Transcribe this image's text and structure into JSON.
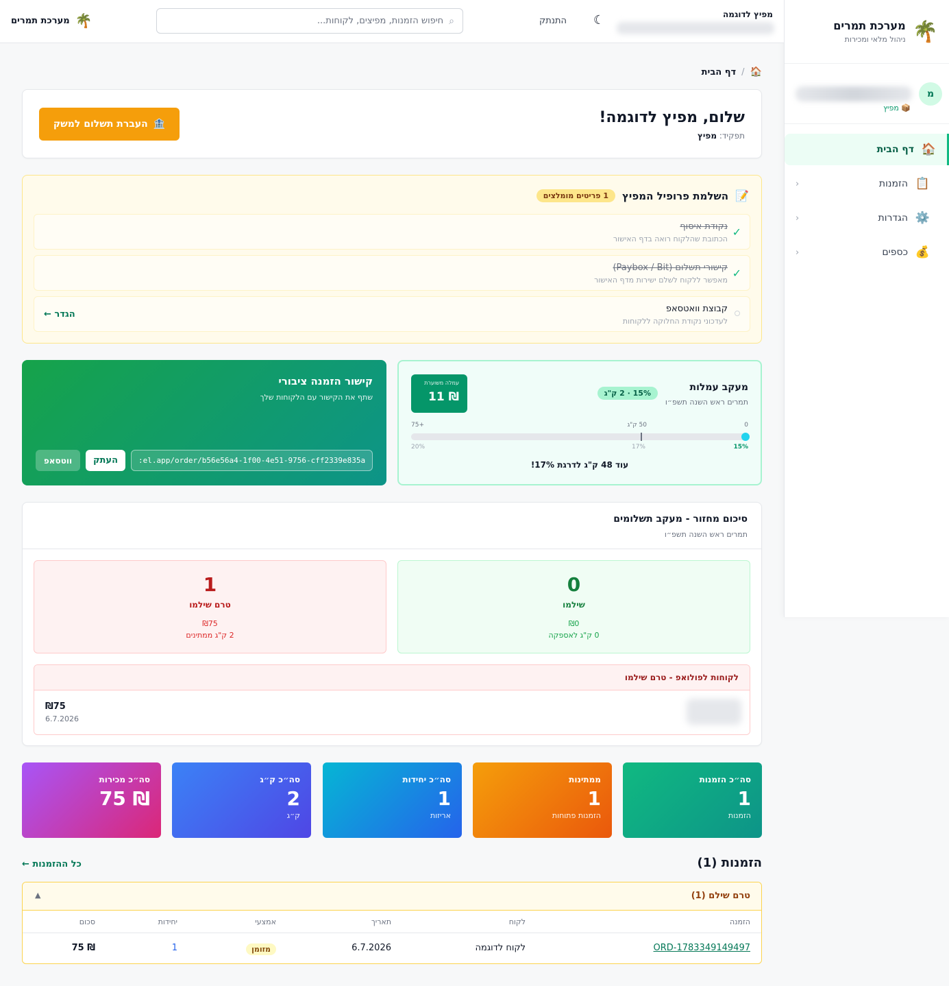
{
  "sidebar": {
    "brand_title": "מערכת תמרים",
    "brand_subtitle": "ניהול מלאי ומכירות",
    "avatar_letter": "מ",
    "role_tag": "📦 מפיץ",
    "items": [
      {
        "label": "דף הבית",
        "icon": "house-icon",
        "glyph": "🏠",
        "active": true
      },
      {
        "label": "הזמנות",
        "icon": "clipboard-icon",
        "glyph": "📋"
      },
      {
        "label": "הגדרות",
        "icon": "gear-icon",
        "glyph": "⚙️"
      },
      {
        "label": "כספים",
        "icon": "money-bag-icon",
        "glyph": "💰"
      }
    ]
  },
  "topbar": {
    "user_name": "מפיץ לדוגמה",
    "logout": "התנתק",
    "search_placeholder": "חיפוש הזמנות, מפיצים, לקוחות...",
    "brand": "מערכת תמרים"
  },
  "breadcrumb": {
    "current": "דף הבית"
  },
  "welcome": {
    "title": "שלום, מפיץ לדוגמה!",
    "role_label": "תפקיד:",
    "role_value": "מפיץ",
    "transfer_button": "העברת תשלום למשק"
  },
  "profile": {
    "title": "השלמת פרופיל המפיץ",
    "badge": "1 פריטים מומלצים",
    "items": [
      {
        "title": "נקודת איסוף",
        "subtitle": "הכתובת שהלקוח רואה בדף האישור",
        "done": true
      },
      {
        "title": "קישורי תשלום (Paybox / Bit)",
        "subtitle": "מאפשר ללקוח לשלם ישירות מדף האישור",
        "done": true
      },
      {
        "title": "קבוצת וואטסאפ",
        "subtitle": "לעדכוני נקודת החלוקה ללקוחות",
        "done": false,
        "action": "הגדר ←"
      }
    ]
  },
  "public_link": {
    "title": "קישור הזמנה ציבורי",
    "subtitle": "שתף את הקישור עם הלקוחות שלך",
    "url": ":el.app/order/b56e56a4-1f00-4e51-9756-cff2339e835a",
    "copy_button": "העתק",
    "whatsapp_button": "ווטסאפ"
  },
  "commission": {
    "title": "מעקב עמלות",
    "subtitle": "תמרים ראש השנה תשפ״ו",
    "pill": "15% · 2 ק\"ג",
    "box_label": "עמלה משוערת",
    "box_value": "₪ 11",
    "scale": [
      "0",
      "50 ק\"ג",
      "+75"
    ],
    "pcts": [
      "15%",
      "17%",
      "20%"
    ],
    "progress_kg": 2,
    "max_kg": 75,
    "note": "עוד 48 ק\"ג לדרגת 17%!"
  },
  "cycle": {
    "title": "סיכום מחזור - מעקב תשלומים",
    "subtitle": "תמרים ראש השנה תשפ״ו",
    "paid": {
      "num": "0",
      "label": "שילמו",
      "amount": "₪0",
      "kg": "0 ק\"ג לאספקה"
    },
    "unpaid": {
      "num": "1",
      "label": "טרם שילמו",
      "amount": "₪75",
      "kg": "2 ק\"ג ממתינים"
    },
    "followup_title": "לקוחות לפולואפ - טרם שילמו",
    "followup_amount": "₪75",
    "followup_date": "6.7.2026"
  },
  "kpis": [
    {
      "label": "סה״כ הזמנות",
      "value": "1",
      "sub": "הזמנות"
    },
    {
      "label": "ממתינות",
      "value": "1",
      "sub": "הזמנות פתוחות"
    },
    {
      "label": "סה״כ יחידות",
      "value": "1",
      "sub": "אריזות"
    },
    {
      "label": "סה״כ ק״ג",
      "value": "2",
      "sub": "ק״ג"
    },
    {
      "label": "סה״כ מכירות",
      "value": "₪ 75",
      "sub": ""
    }
  ],
  "orders": {
    "heading": "הזמנות (1)",
    "all_link": "כל ההזמנות ←",
    "group_title": "טרם שילם (1)",
    "columns": [
      "הזמנה",
      "לקוח",
      "תאריך",
      "אמצעי",
      "יחידות",
      "סכום"
    ],
    "row": {
      "order": "ORD-1783349149497",
      "customer": "לקוח לדוגמה",
      "date": "6.7.2026",
      "method": "מזומן",
      "units": "1",
      "sum": "₪ 75"
    }
  },
  "colors": {
    "accent": "#10b981",
    "warning": "#f59e0b",
    "danger": "#dc2626"
  }
}
